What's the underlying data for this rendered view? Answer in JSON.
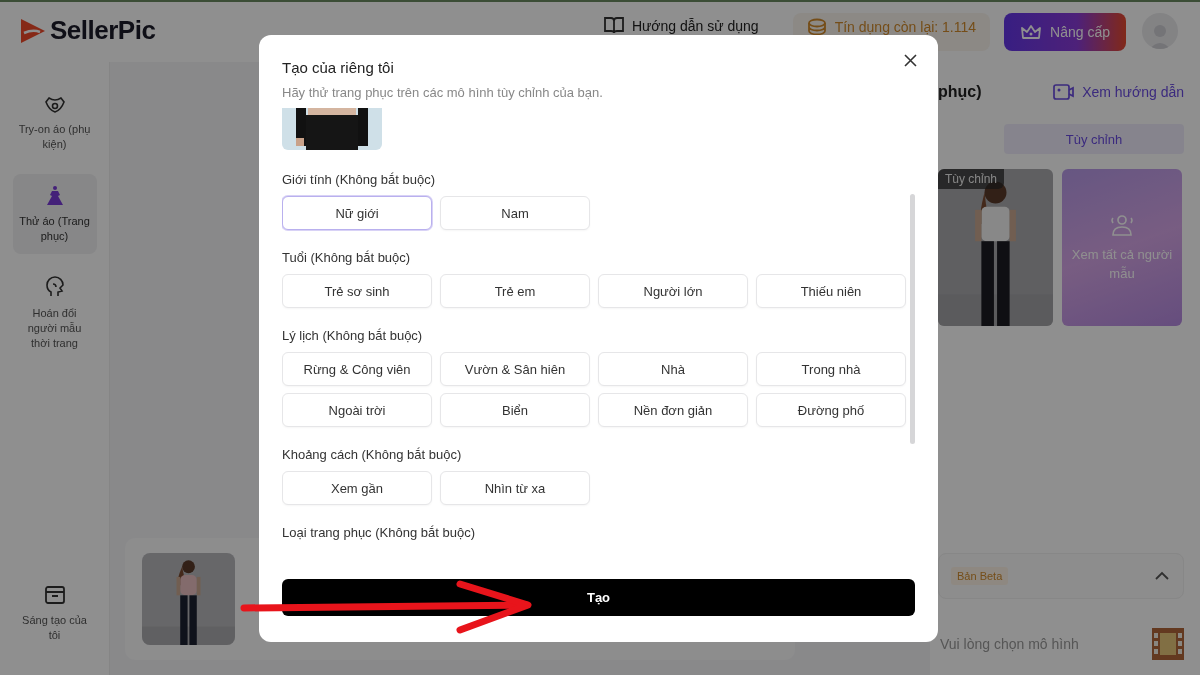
{
  "header": {
    "logo": "SellerPic",
    "guide": "Hướng dẫn sử dụng",
    "credits": "Tín dụng còn lại: 1.114",
    "upgrade": "Nâng cấp"
  },
  "sidebar": {
    "items": [
      {
        "label": "Try-on áo (phụ kiện)",
        "selected": false
      },
      {
        "label": "Thử áo (Trang phục)",
        "selected": true
      },
      {
        "label": "Hoán đổi người mẫu thời trang",
        "selected": false
      }
    ],
    "bottom_item": "Sáng tạo của tôi"
  },
  "right_panel": {
    "title": "phục)",
    "tutorial_link": "Xem hướng dẫn",
    "tabs": [
      {
        "label": "Tùy chỉnh",
        "selected": true
      }
    ],
    "cards": [
      {
        "tag": "Tùy chỉnh"
      },
      {
        "kind": "all",
        "label": "Xem tất cả người mẫu"
      }
    ],
    "beta_tag": "Bản Beta",
    "prompt": "Vui lòng chọn mô hình"
  },
  "modal": {
    "title": "Tạo của riêng tôi",
    "subtitle": "Hãy thử trang phục trên các mô hình tùy chỉnh của bạn.",
    "sections": [
      {
        "label": "Giới tính (Không bắt buộc)",
        "options": [
          {
            "label": "Nữ giới",
            "selected": true
          },
          {
            "label": "Nam",
            "selected": false
          }
        ]
      },
      {
        "label": "Tuổi (Không bắt buộc)",
        "options": [
          {
            "label": "Trẻ sơ sinh",
            "selected": false
          },
          {
            "label": "Trẻ em",
            "selected": false
          },
          {
            "label": "Người lớn",
            "selected": false
          },
          {
            "label": "Thiếu niên",
            "selected": false
          }
        ]
      },
      {
        "label": "Lý lịch (Không bắt buộc)",
        "options": [
          {
            "label": "Rừng & Công viên",
            "selected": false
          },
          {
            "label": "Vườn & Sân hiên",
            "selected": false
          },
          {
            "label": "Nhà",
            "selected": false
          },
          {
            "label": "Trong nhà",
            "selected": false
          },
          {
            "label": "Ngoài trời",
            "selected": false
          },
          {
            "label": "Biển",
            "selected": false
          },
          {
            "label": "Nền đơn giản",
            "selected": false
          },
          {
            "label": "Đường phố",
            "selected": false
          }
        ]
      },
      {
        "label": "Khoảng cách (Không bắt buộc)",
        "options": [
          {
            "label": "Xem gần",
            "selected": false
          },
          {
            "label": "Nhìn từ xa",
            "selected": false
          }
        ]
      },
      {
        "label": "Loại trang phục (Không bắt buộc)"
      }
    ],
    "submit": "Tạo"
  }
}
